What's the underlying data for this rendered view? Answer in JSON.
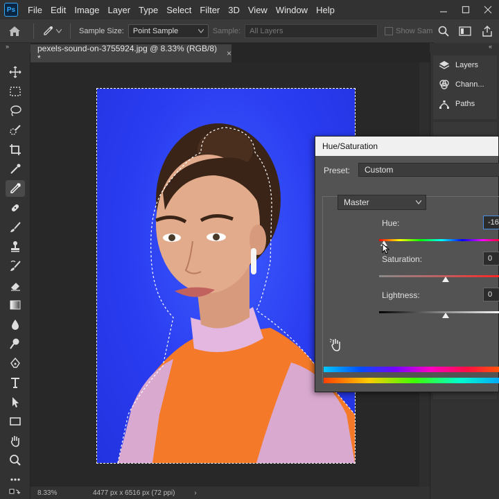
{
  "app": {
    "logo_text": "Ps"
  },
  "menu": [
    "File",
    "Edit",
    "Image",
    "Layer",
    "Type",
    "Select",
    "Filter",
    "3D",
    "View",
    "Window",
    "Help"
  ],
  "options": {
    "sample_size_label": "Sample Size:",
    "sample_size_value": "Point Sample",
    "sample_label": "Sample:",
    "sample_value": "All Layers",
    "show_sampling_label": "Show Sam"
  },
  "document": {
    "tab_title": "pexels-sound-on-3755924.jpg @ 8.33% (RGB/8) *",
    "close_glyph": "×"
  },
  "status": {
    "zoom": "8.33%",
    "size": "4477 px x 6516 px (72 ppi)",
    "arrow": "›"
  },
  "panels": [
    {
      "label": "Layers",
      "icon": "layers-icon"
    },
    {
      "label": "Chann...",
      "icon": "channels-icon"
    },
    {
      "label": "Paths",
      "icon": "paths-icon"
    }
  ],
  "dialog": {
    "title": "Hue/Saturation",
    "preset_label": "Preset:",
    "preset_value": "Custom",
    "channel_value": "Master",
    "hue_label": "Hue:",
    "hue_value": "-16",
    "saturation_label": "Saturation:",
    "saturation_value": "0",
    "lightness_label": "Lightness:",
    "lightness_value": "0"
  },
  "colors": {
    "background_blue": "#2a3cf0",
    "accent": "#31a8ff"
  }
}
